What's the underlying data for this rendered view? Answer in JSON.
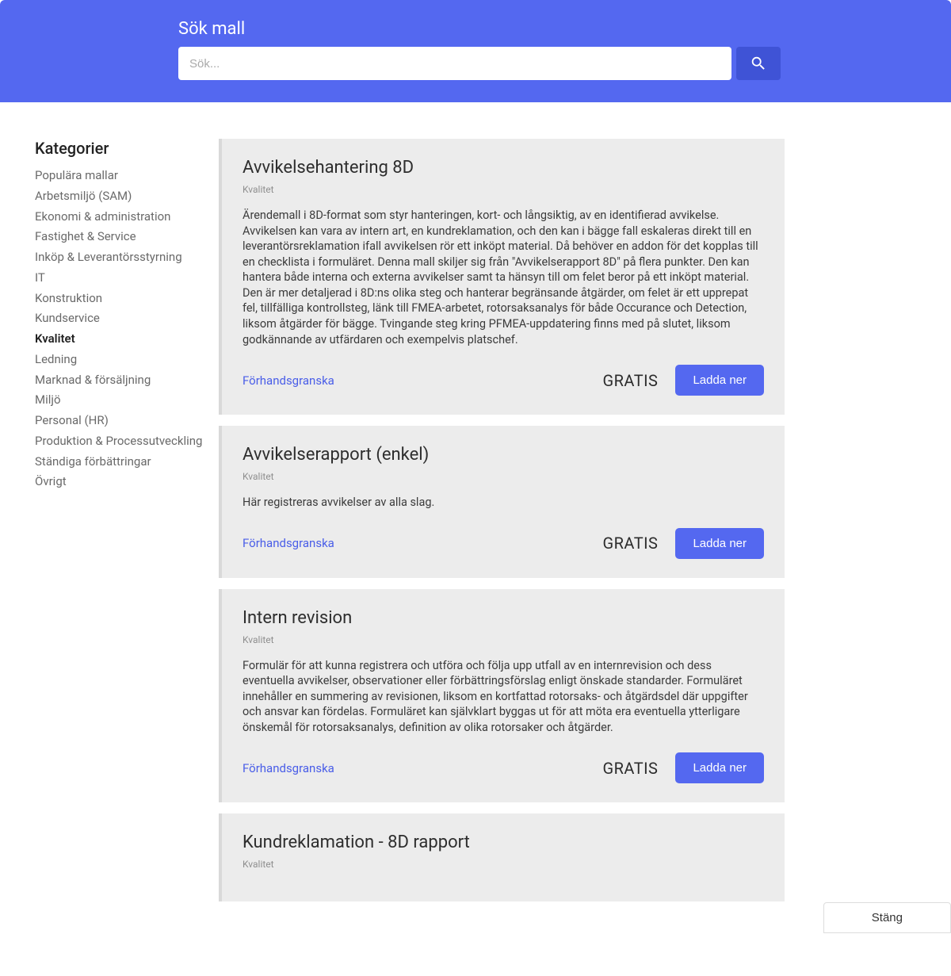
{
  "search": {
    "label": "Sök mall",
    "placeholder": "Sök..."
  },
  "sidebar": {
    "title": "Kategorier",
    "items": [
      {
        "label": "Populära mallar",
        "active": false
      },
      {
        "label": "Arbetsmiljö (SAM)",
        "active": false
      },
      {
        "label": "Ekonomi & administration",
        "active": false
      },
      {
        "label": "Fastighet & Service",
        "active": false
      },
      {
        "label": "Inköp & Leverantörsstyrning",
        "active": false
      },
      {
        "label": "IT",
        "active": false
      },
      {
        "label": "Konstruktion",
        "active": false
      },
      {
        "label": "Kundservice",
        "active": false
      },
      {
        "label": "Kvalitet",
        "active": true
      },
      {
        "label": "Ledning",
        "active": false
      },
      {
        "label": "Marknad & försäljning",
        "active": false
      },
      {
        "label": "Miljö",
        "active": false
      },
      {
        "label": "Personal (HR)",
        "active": false
      },
      {
        "label": "Produktion & Processutveckling",
        "active": false
      },
      {
        "label": "Ständiga förbättringar",
        "active": false
      },
      {
        "label": "Övrigt",
        "active": false
      }
    ]
  },
  "cards": [
    {
      "title": "Avvikelsehantering 8D",
      "category": "Kvalitet",
      "description": "Ärendemall i 8D-format som styr hanteringen, kort- och långsiktig, av en identifierad avvikelse. Avvikelsen kan vara av intern art, en kundreklamation, och den kan i bägge fall eskaleras direkt till en leverantörsreklamation ifall avvikelsen rör ett inköpt material. Då behöver en addon för det kopplas till en checklista i formuläret. Denna mall skiljer sig från \"Avvikelserapport 8D\" på flera punkter. Den kan hantera både interna och externa avvikelser samt ta hänsyn till om felet beror på ett inköpt material. Den är mer detaljerad i 8D:ns olika steg och hanterar begränsande åtgärder, om felet är ett upprepat fel, tillfälliga kontrollsteg, länk till FMEA-arbetet, rotorsaksanalys för både Occurance och Detection, liksom åtgärder för bägge. Tvingande steg kring PFMEA-uppdatering finns med på slutet, liksom godkännande av utfärdaren och exempelvis platschef.",
      "preview": "Förhandsgranska",
      "price": "GRATIS",
      "download": "Ladda ner"
    },
    {
      "title": "Avvikelserapport (enkel)",
      "category": "Kvalitet",
      "description": "Här registreras avvikelser av alla slag.",
      "preview": "Förhandsgranska",
      "price": "GRATIS",
      "download": "Ladda ner"
    },
    {
      "title": "Intern revision",
      "category": "Kvalitet",
      "description": "Formulär för att kunna registrera och utföra och följa upp utfall av en internrevision och dess eventuella avvikelser, observationer eller förbättringsförslag enligt önskade standarder. Formuläret innehåller en summering av revisionen, liksom en kortfattad rotorsaks- och åtgärdsdel där uppgifter och ansvar kan fördelas. Formuläret kan självklart byggas ut för att möta era eventuella ytterligare önskemål för rotorsaksanalys, definition av olika rotorsaker och åtgärder.",
      "preview": "Förhandsgranska",
      "price": "GRATIS",
      "download": "Ladda ner"
    },
    {
      "title": "Kundreklamation - 8D rapport",
      "category": "Kvalitet",
      "description": "",
      "preview": "",
      "price": "",
      "download": ""
    }
  ],
  "close_label": "Stäng"
}
